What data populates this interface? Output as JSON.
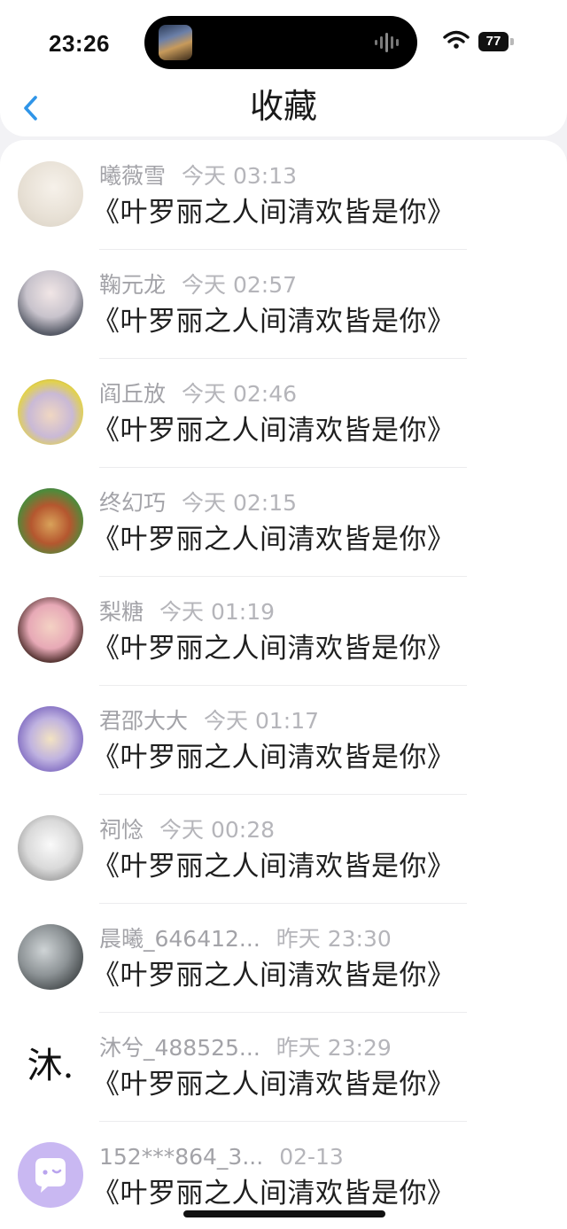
{
  "status_bar": {
    "time": "23:26",
    "battery": "77",
    "icons": [
      "now-playing-artwork-icon",
      "audio-waveform-icon",
      "wifi-icon",
      "battery-icon"
    ]
  },
  "nav": {
    "title": "收藏",
    "back_icon": "chevron-left-icon",
    "accent_color": "#2f95e8"
  },
  "favorites": [
    {
      "user": "曦薇雪",
      "time": "今天 03:13",
      "title": "《叶罗丽之人间清欢皆是你》"
    },
    {
      "user": "鞠元龙",
      "time": "今天 02:57",
      "title": "《叶罗丽之人间清欢皆是你》"
    },
    {
      "user": "阎丘放",
      "time": "今天 02:46",
      "title": "《叶罗丽之人间清欢皆是你》"
    },
    {
      "user": "终幻巧",
      "time": "今天 02:15",
      "title": "《叶罗丽之人间清欢皆是你》"
    },
    {
      "user": "梨糖",
      "time": "今天 01:19",
      "title": "《叶罗丽之人间清欢皆是你》"
    },
    {
      "user": "君邵大大",
      "time": "今天 01:17",
      "title": "《叶罗丽之人间清欢皆是你》"
    },
    {
      "user": "祠惗",
      "time": "今天 00:28",
      "title": "《叶罗丽之人间清欢皆是你》"
    },
    {
      "user": "晨曦_646412...",
      "time": "昨天 23:30",
      "title": "《叶罗丽之人间清欢皆是你》"
    },
    {
      "user": "沐兮_488525...",
      "time": "昨天 23:29",
      "title": "《叶罗丽之人间清欢皆是你》",
      "avatar_text": "沐."
    },
    {
      "user": "152***864_3...",
      "time": "02-13",
      "title": "《叶罗丽之人间清欢皆是你》",
      "avatar_icon": "chat-bubble-icon"
    }
  ]
}
